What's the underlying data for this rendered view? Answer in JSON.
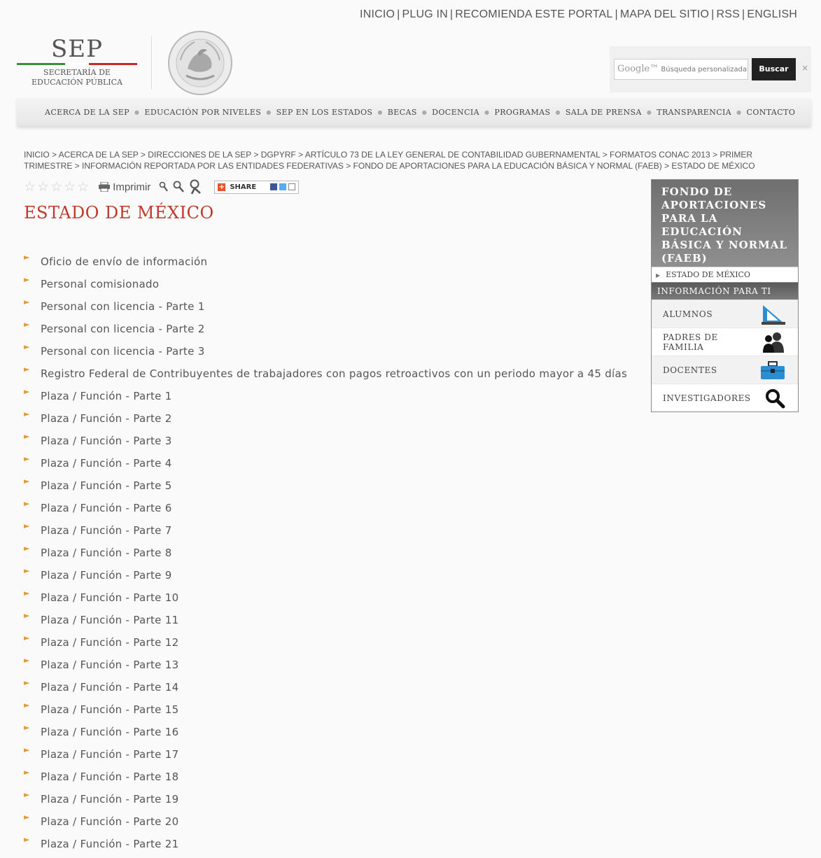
{
  "top_links": [
    "INICIO",
    "PLUG IN",
    "RECOMIENDA ESTE PORTAL",
    "MAPA DEL SITIO",
    "RSS",
    "ENGLISH"
  ],
  "logo": {
    "title": "SEP",
    "line1": "SECRETARÍA DE",
    "line2": "EDUCACIÓN PÚBLICA"
  },
  "search": {
    "brand": "Google™",
    "placeholder": "Búsqueda personalizada",
    "button_label": "Buscar",
    "clear": "×"
  },
  "nav": [
    "Acerca de la SEP",
    "Educación por niveles",
    "SEP en los Estados",
    "Becas",
    "Docencia",
    "Programas",
    "Sala de Prensa",
    "Transparencia",
    "Contacto"
  ],
  "breadcrumb": "INICIO > ACERCA DE LA SEP > DIRECCIONES DE LA SEP > DGPYRF > ARTÍCULO 73 DE LA LEY GENERAL DE CONTABILIDAD GUBERNAMENTAL > FORMATOS CONAC 2013 > PRIMER TRIMESTRE > INFORMACIÓN REPORTADA POR LAS ENTIDADES FEDERATIVAS > FONDO DE APORTACIONES PARA LA EDUCACIÓN BÁSICA Y NORMAL (FAEB) > ESTADO DE MÉXICO",
  "tools": {
    "stars": "☆☆☆☆☆",
    "print_label": "Imprimir",
    "share_label": "SHARE"
  },
  "page_title": "ESTADO DE MÉXICO",
  "links": [
    "Oficio de envío de información",
    "Personal comisionado",
    "Personal con licencia - Parte 1",
    "Personal con licencia - Parte 2",
    "Personal con licencia - Parte 3",
    "Registro Federal de Contribuyentes de trabajadores con pagos retroactivos con un periodo mayor a 45 días",
    "Plaza / Función - Parte 1",
    "Plaza / Función - Parte 2",
    "Plaza / Función - Parte 3",
    "Plaza / Función - Parte 4",
    "Plaza / Función - Parte 5",
    "Plaza / Función - Parte 6",
    "Plaza / Función - Parte 7",
    "Plaza / Función - Parte 8",
    "Plaza / Función - Parte 9",
    "Plaza / Función - Parte 10",
    "Plaza / Función - Parte 11",
    "Plaza / Función - Parte 12",
    "Plaza / Función - Parte 13",
    "Plaza / Función - Parte 14",
    "Plaza / Función - Parte 15",
    "Plaza / Función - Parte 16",
    "Plaza / Función - Parte 17",
    "Plaza / Función - Parte 18",
    "Plaza / Función - Parte 19",
    "Plaza / Función - Parte 20",
    "Plaza / Función - Parte 21"
  ],
  "sidebar_fund": {
    "title": "FONDO DE APORTACIONES PARA LA EDUCACIÓN BÁSICA Y NORMAL (FAEB)",
    "item": "ESTADO DE MÉXICO"
  },
  "sidebar_info": {
    "title": "INFORMACIÓN PARA TI",
    "items": [
      {
        "label": "ALUMNOS",
        "icon": "ruler-triangle-icon"
      },
      {
        "label": "PADRES DE FAMILIA",
        "icon": "parents-icon"
      },
      {
        "label": "DOCENTES",
        "icon": "briefcase-icon"
      },
      {
        "label": "INVESTIGADORES",
        "icon": "magnifier-icon"
      }
    ]
  },
  "colors": {
    "title_red": "#c0392b",
    "bullet_orange": "#e89a2b",
    "flag_green": "#3a8f3f",
    "flag_red": "#c42b2b",
    "icon_blue": "#2a8ed1"
  }
}
